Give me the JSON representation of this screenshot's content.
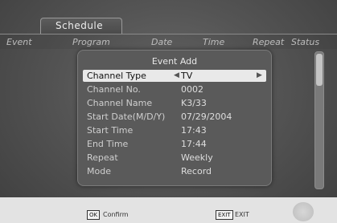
{
  "tab": {
    "label": "Schedule"
  },
  "columns": [
    "Event",
    "Program",
    "Date",
    "Time",
    "Repeat",
    "Status"
  ],
  "dialog": {
    "title": "Event Add",
    "rows": [
      {
        "label": "Channel Type",
        "value": "TV"
      },
      {
        "label": "Channel No.",
        "value": "0002"
      },
      {
        "label": "Channel Name",
        "value": "K3/33"
      },
      {
        "label": "Start Date(M/D/Y)",
        "value": "07/29/2004"
      },
      {
        "label": "Start Time",
        "value": "17:43"
      },
      {
        "label": "End Time",
        "value": "17:44"
      },
      {
        "label": "Repeat",
        "value": "Weekly"
      },
      {
        "label": "Mode",
        "value": "Record"
      }
    ],
    "selected_index": 0
  },
  "footer": {
    "ok_key": "OK",
    "ok_label": "Confirm",
    "exit_key": "EXIT",
    "exit_label": "EXIT"
  }
}
